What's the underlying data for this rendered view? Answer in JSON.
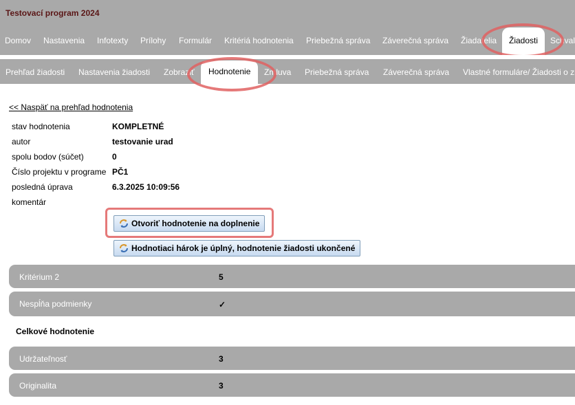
{
  "app_title": "Testovací program 2024",
  "main_nav": [
    "Domov",
    "Nastavenia",
    "Infotexty",
    "Prílohy",
    "Formulár",
    "Kritériá hodnotenia",
    "Priebežná správa",
    "Záverečná správa",
    "Žiadatelia",
    "Žiadosti",
    "Schval"
  ],
  "sub_nav": [
    "Prehľad žiadosti",
    "Nastavenia žiadosti",
    "Zobraziť",
    "Hodnotenie",
    "Zmluva",
    "Priebežná správa",
    "Záverečná správa",
    "Vlastné formuláre/ Žiadosti o zmenu"
  ],
  "back_link": "<< Naspäť na prehľad hodnotenia",
  "details": [
    {
      "label": "stav hodnotenia",
      "value": "KOMPLETNÉ"
    },
    {
      "label": "autor",
      "value": "testovanie urad"
    },
    {
      "label": "spolu bodov (súčet)",
      "value": "0"
    },
    {
      "label": "Číslo projektu v programe",
      "value": "PČ1"
    },
    {
      "label": "posledná úprava",
      "value": "6.3.2025 10:09:56"
    },
    {
      "label": "komentár",
      "value": ""
    }
  ],
  "buttons": {
    "reopen": "Otvoriť hodnotenie na doplnenie",
    "finish": "Hodnotiaci hárok je úplný, hodnotenie žiadosti ukončené"
  },
  "criteria": [
    {
      "name": "Kritérium 2",
      "score": "5"
    },
    {
      "name": "Nespĺňa podmienky",
      "score": "✓"
    }
  ],
  "overall_title": "Celkové hodnotenie",
  "overall": [
    {
      "name": "Udržateľnosť",
      "score": "3"
    },
    {
      "name": "Originalita",
      "score": "3"
    }
  ],
  "colors": {
    "bar": "#a9a9a9",
    "highlight": "#e06262",
    "title": "#5a1616"
  }
}
